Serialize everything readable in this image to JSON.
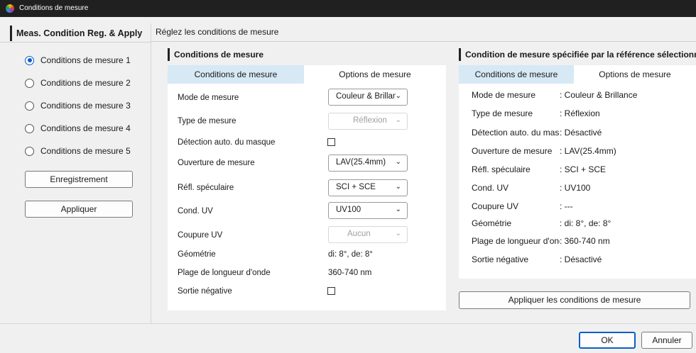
{
  "window": {
    "title": "Conditions de mesure"
  },
  "sidebar": {
    "title": "Meas. Condition Reg. & Apply",
    "items": [
      {
        "label": "Conditions de mesure 1",
        "checked": true
      },
      {
        "label": "Conditions de mesure 2",
        "checked": false
      },
      {
        "label": "Conditions de mesure 3",
        "checked": false
      },
      {
        "label": "Conditions de mesure 4",
        "checked": false
      },
      {
        "label": "Conditions de mesure 5",
        "checked": false
      }
    ],
    "register_label": "Enregistrement",
    "apply_label": "Appliquer"
  },
  "main": {
    "heading": "Réglez les conditions de mesure"
  },
  "left_panel": {
    "title": "Conditions de mesure",
    "tabs": [
      "Conditions de mesure",
      "Options de mesure"
    ],
    "rows": {
      "mode": {
        "label": "Mode de mesure",
        "value": "Couleur & Brillance"
      },
      "type": {
        "label": "Type de mesure",
        "value": "Réflexion"
      },
      "mask": {
        "label": "Détection auto. du masque"
      },
      "aperture": {
        "label": "Ouverture de mesure",
        "value": "LAV(25.4mm)"
      },
      "specular": {
        "label": "Réfl. spéculaire",
        "value": "SCI + SCE"
      },
      "uv": {
        "label": "Cond. UV",
        "value": "UV100"
      },
      "uvcut": {
        "label": "Coupure UV",
        "value": "Aucun"
      },
      "geometry": {
        "label": "Géométrie",
        "value": "di: 8°, de: 8°"
      },
      "wavelength": {
        "label": "Plage de longueur d'onde",
        "value": "360-740 nm"
      },
      "negative": {
        "label": "Sortie négative"
      }
    }
  },
  "right_panel": {
    "title": "Condition de mesure spécifiée par la référence sélectionn",
    "tabs": [
      "Conditions de mesure",
      "Options de mesure"
    ],
    "rows": [
      {
        "label": "Mode de mesure",
        "value": ": Couleur & Brillance"
      },
      {
        "label": "Type de mesure",
        "value": ": Réflexion"
      },
      {
        "label": "Détection auto. du masque",
        "value": ": Désactivé"
      },
      {
        "label": "Ouverture de mesure",
        "value": ": LAV(25.4mm)"
      },
      {
        "label": "Réfl. spéculaire",
        "value": ": SCI + SCE"
      },
      {
        "label": "Cond. UV",
        "value": ": UV100"
      },
      {
        "label": "Coupure UV",
        "value": ": ---"
      },
      {
        "label": "Géométrie",
        "value": ": di: 8°, de: 8°"
      },
      {
        "label": "Plage de longueur d'onde",
        "value": ": 360-740 nm"
      },
      {
        "label": "Sortie négative",
        "value": ": Désactivé"
      }
    ],
    "apply_label": "Appliquer les conditions de mesure"
  },
  "footer": {
    "ok_label": "OK",
    "cancel_label": "Annuler"
  },
  "colors": {
    "tab_active": "#d6e9f5",
    "radio_accent": "#0a5fc9",
    "titlebar": "#202020"
  }
}
